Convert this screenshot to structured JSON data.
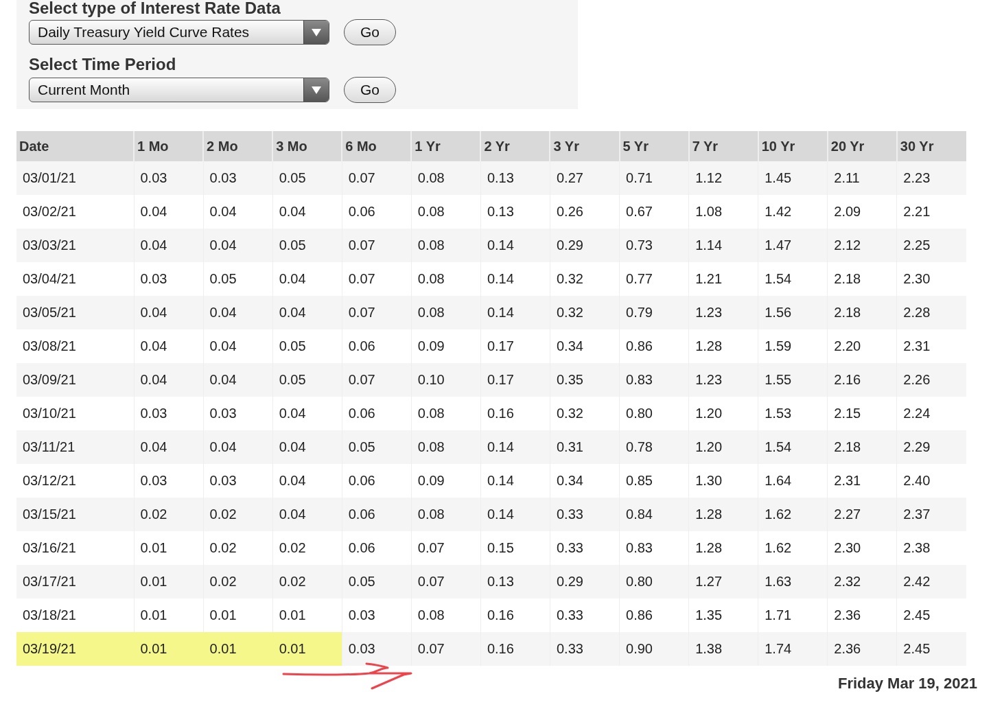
{
  "form": {
    "type_label": "Select type of Interest Rate Data",
    "type_value": "Daily Treasury Yield Curve Rates",
    "type_button": "Go",
    "period_label": "Select Time Period",
    "period_value": "Current Month",
    "period_button": "Go"
  },
  "table": {
    "columns": [
      "Date",
      "1 Mo",
      "2 Mo",
      "3 Mo",
      "6 Mo",
      "1 Yr",
      "2 Yr",
      "3 Yr",
      "5 Yr",
      "7 Yr",
      "10 Yr",
      "20 Yr",
      "30 Yr"
    ],
    "rows": [
      {
        "cells": [
          "03/01/21",
          "0.03",
          "0.03",
          "0.05",
          "0.07",
          "0.08",
          "0.13",
          "0.27",
          "0.71",
          "1.12",
          "1.45",
          "2.11",
          "2.23"
        ],
        "highlighted": false
      },
      {
        "cells": [
          "03/02/21",
          "0.04",
          "0.04",
          "0.04",
          "0.06",
          "0.08",
          "0.13",
          "0.26",
          "0.67",
          "1.08",
          "1.42",
          "2.09",
          "2.21"
        ],
        "highlighted": false
      },
      {
        "cells": [
          "03/03/21",
          "0.04",
          "0.04",
          "0.05",
          "0.07",
          "0.08",
          "0.14",
          "0.29",
          "0.73",
          "1.14",
          "1.47",
          "2.12",
          "2.25"
        ],
        "highlighted": false
      },
      {
        "cells": [
          "03/04/21",
          "0.03",
          "0.05",
          "0.04",
          "0.07",
          "0.08",
          "0.14",
          "0.32",
          "0.77",
          "1.21",
          "1.54",
          "2.18",
          "2.30"
        ],
        "highlighted": false
      },
      {
        "cells": [
          "03/05/21",
          "0.04",
          "0.04",
          "0.04",
          "0.07",
          "0.08",
          "0.14",
          "0.32",
          "0.79",
          "1.23",
          "1.56",
          "2.18",
          "2.28"
        ],
        "highlighted": false
      },
      {
        "cells": [
          "03/08/21",
          "0.04",
          "0.04",
          "0.05",
          "0.06",
          "0.09",
          "0.17",
          "0.34",
          "0.86",
          "1.28",
          "1.59",
          "2.20",
          "2.31"
        ],
        "highlighted": false
      },
      {
        "cells": [
          "03/09/21",
          "0.04",
          "0.04",
          "0.05",
          "0.07",
          "0.10",
          "0.17",
          "0.35",
          "0.83",
          "1.23",
          "1.55",
          "2.16",
          "2.26"
        ],
        "highlighted": false
      },
      {
        "cells": [
          "03/10/21",
          "0.03",
          "0.03",
          "0.04",
          "0.06",
          "0.08",
          "0.16",
          "0.32",
          "0.80",
          "1.20",
          "1.53",
          "2.15",
          "2.24"
        ],
        "highlighted": false
      },
      {
        "cells": [
          "03/11/21",
          "0.04",
          "0.04",
          "0.04",
          "0.05",
          "0.08",
          "0.14",
          "0.31",
          "0.78",
          "1.20",
          "1.54",
          "2.18",
          "2.29"
        ],
        "highlighted": false
      },
      {
        "cells": [
          "03/12/21",
          "0.03",
          "0.03",
          "0.04",
          "0.06",
          "0.09",
          "0.14",
          "0.34",
          "0.85",
          "1.30",
          "1.64",
          "2.31",
          "2.40"
        ],
        "highlighted": false
      },
      {
        "cells": [
          "03/15/21",
          "0.02",
          "0.02",
          "0.04",
          "0.06",
          "0.08",
          "0.14",
          "0.33",
          "0.84",
          "1.28",
          "1.62",
          "2.27",
          "2.37"
        ],
        "highlighted": false
      },
      {
        "cells": [
          "03/16/21",
          "0.01",
          "0.02",
          "0.02",
          "0.06",
          "0.07",
          "0.15",
          "0.33",
          "0.83",
          "1.28",
          "1.62",
          "2.30",
          "2.38"
        ],
        "highlighted": false
      },
      {
        "cells": [
          "03/17/21",
          "0.01",
          "0.02",
          "0.02",
          "0.05",
          "0.07",
          "0.13",
          "0.29",
          "0.80",
          "1.27",
          "1.63",
          "2.32",
          "2.42"
        ],
        "highlighted": false
      },
      {
        "cells": [
          "03/18/21",
          "0.01",
          "0.01",
          "0.01",
          "0.03",
          "0.08",
          "0.16",
          "0.33",
          "0.86",
          "1.35",
          "1.71",
          "2.36",
          "2.45"
        ],
        "highlighted": false
      },
      {
        "cells": [
          "03/19/21",
          "0.01",
          "0.01",
          "0.01",
          "0.03",
          "0.07",
          "0.16",
          "0.33",
          "0.90",
          "1.38",
          "1.74",
          "2.36",
          "2.45"
        ],
        "highlighted": true
      }
    ]
  },
  "arrow": true,
  "date_line": "Friday Mar 19, 2021"
}
